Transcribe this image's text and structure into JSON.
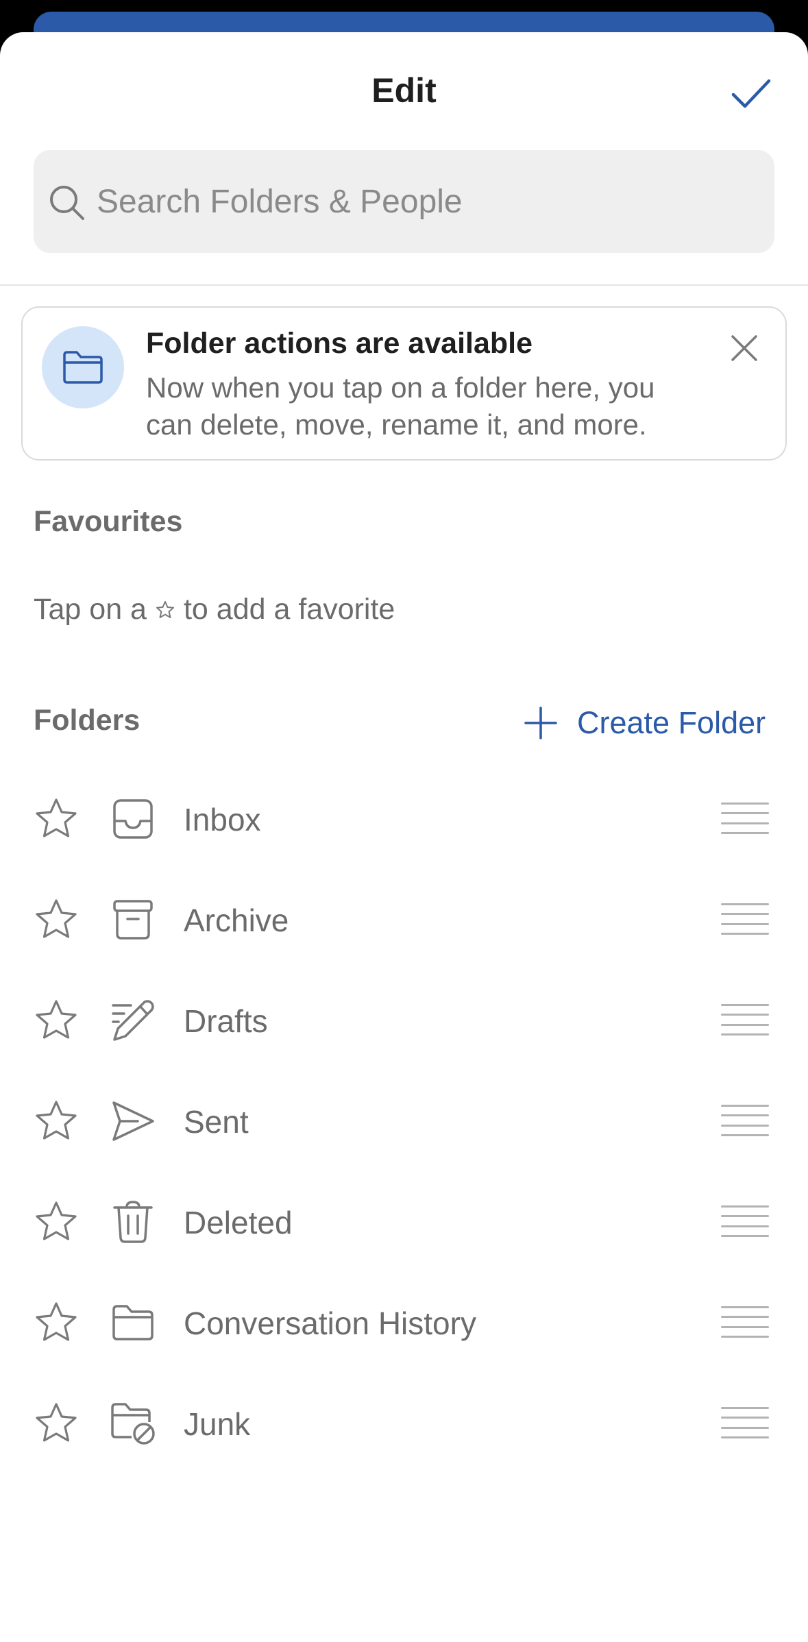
{
  "header": {
    "title": "Edit",
    "done_icon": "checkmark-icon"
  },
  "search": {
    "placeholder": "Search Folders & People",
    "icon": "search-icon"
  },
  "notice": {
    "icon": "folder-icon",
    "title": "Folder actions are available",
    "body": "Now when you tap on a folder here, you can delete, move, rename it, and more.",
    "close_icon": "close-icon"
  },
  "favourites": {
    "label": "Favourites",
    "hint_before": "Tap on a",
    "hint_icon": "star-icon",
    "hint_after": "to add a favorite"
  },
  "folders": {
    "label": "Folders",
    "create_label": "Create Folder",
    "create_icon": "plus-icon",
    "items": [
      {
        "label": "Inbox",
        "icon": "inbox-icon"
      },
      {
        "label": "Archive",
        "icon": "archive-icon"
      },
      {
        "label": "Drafts",
        "icon": "pencil-icon"
      },
      {
        "label": "Sent",
        "icon": "send-icon"
      },
      {
        "label": "Deleted",
        "icon": "trash-icon"
      },
      {
        "label": "Conversation History",
        "icon": "folder-icon"
      },
      {
        "label": "Junk",
        "icon": "junk-folder-icon"
      }
    ]
  },
  "colors": {
    "accent": "#2a5aa8",
    "text_primary": "#1f1f1f",
    "text_secondary": "#6b6b6b",
    "icon_gray": "#7a7a7a",
    "notice_icon_bg": "#d4e5f9",
    "search_bg": "#efefef"
  }
}
